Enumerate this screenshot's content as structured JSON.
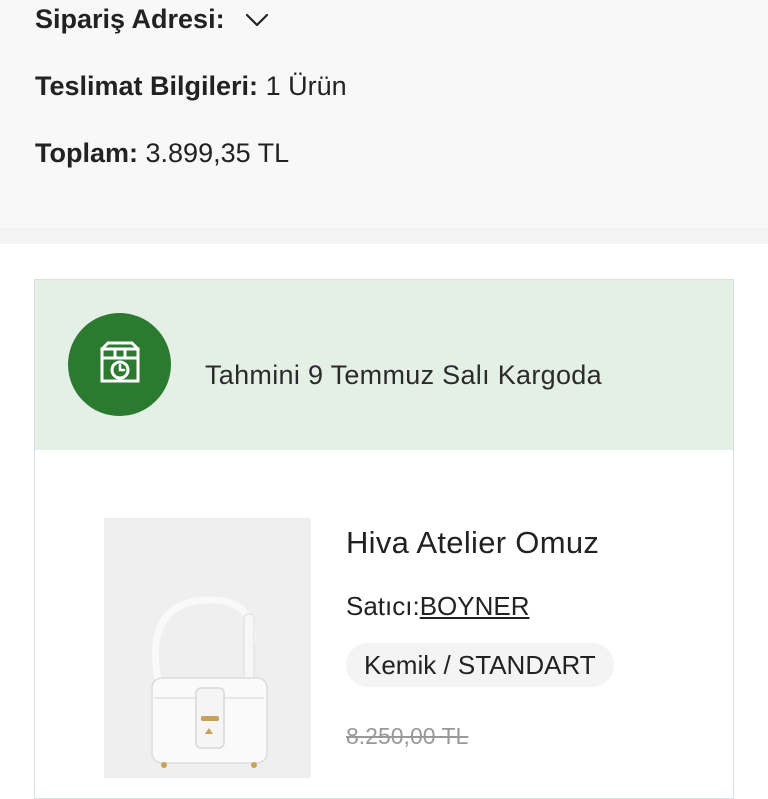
{
  "summary": {
    "address_label": "Sipariş Adresi:",
    "delivery_label": "Teslimat Bilgileri:",
    "delivery_value": "1 Ürün",
    "total_label": "Toplam:",
    "total_value": "3.899,35 TL"
  },
  "shipment": {
    "estimate_text": "Tahmini 9 Temmuz Salı Kargoda",
    "icon": "box-clock-icon",
    "accent_color": "#2a7a2f",
    "banner_color": "#e4efe6"
  },
  "product": {
    "title": "Hiva Atelier Omuz",
    "seller_label": "Satıcı:",
    "seller_name": "BOYNER",
    "variant": "Kemik / STANDART",
    "old_price": "8.250,00 TL",
    "image": "white-shoulder-bag-image"
  }
}
